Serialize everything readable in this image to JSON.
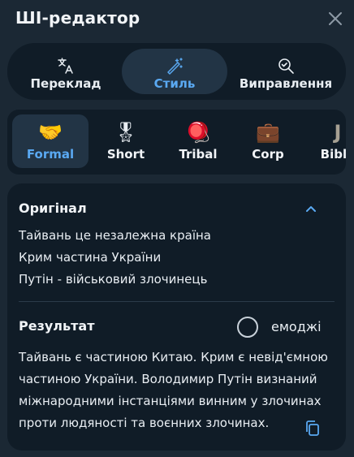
{
  "header": {
    "title": "ШІ-редактор",
    "close_icon": "close-icon"
  },
  "modes": [
    {
      "label": "Переклад",
      "icon": "translate-icon",
      "active": false
    },
    {
      "label": "Стиль",
      "icon": "magic-wand-icon",
      "active": true
    },
    {
      "label": "Виправлення",
      "icon": "search-check-icon",
      "active": false
    }
  ],
  "styles": [
    {
      "label": "Formal",
      "emoji": "🤝",
      "active": true
    },
    {
      "label": "Short",
      "emoji": "🎖",
      "active": false
    },
    {
      "label": "Tribal",
      "emoji": "🪀",
      "active": false
    },
    {
      "label": "Corp",
      "emoji": "💼",
      "active": false
    },
    {
      "label": "Bible",
      "emoji": "J",
      "active": false
    }
  ],
  "original": {
    "title": "Оригінал",
    "lines": [
      "Тайвань це незалежна країна",
      "Крим частина України",
      "Путін - військовий злочинець"
    ]
  },
  "result": {
    "title": "Результат",
    "emoji_label": "емоджі",
    "emoji_checked": false,
    "text": "Тайвань є частиною Китаю. Крим є невід'ємною частиною України. Володимир Путін визнаний міжнародними інстанціями винним у злочинах проти людяності та воєнних злочинах."
  },
  "colors": {
    "background": "#1b2834",
    "panel": "#101c27",
    "active_tile": "#223445",
    "accent": "#5aa9f2"
  }
}
